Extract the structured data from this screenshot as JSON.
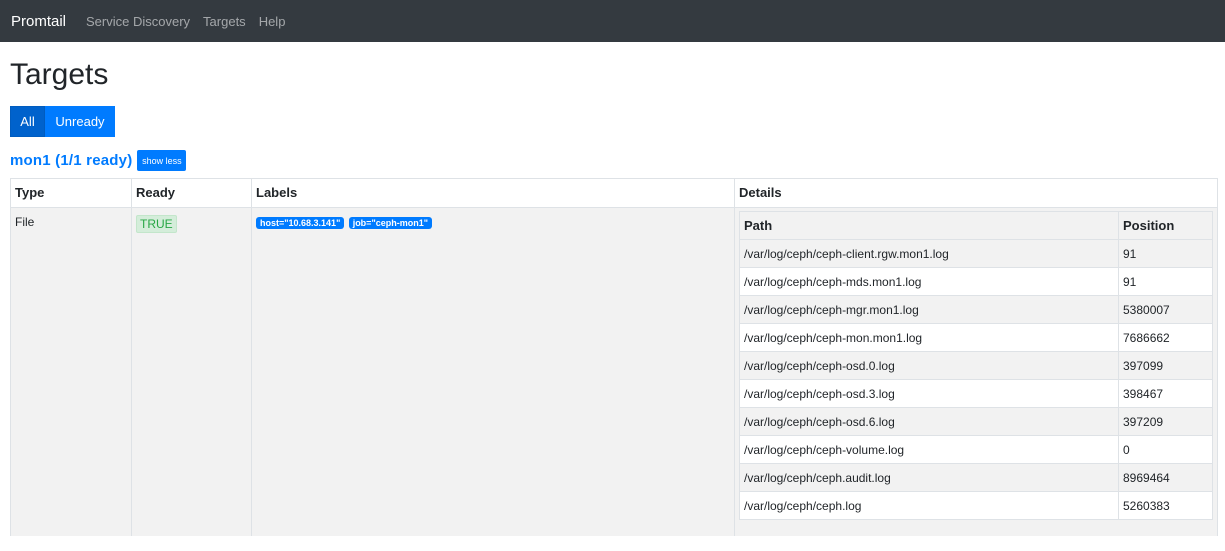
{
  "nav": {
    "brand": "Promtail",
    "links": [
      "Service Discovery",
      "Targets",
      "Help"
    ]
  },
  "page": {
    "title": "Targets"
  },
  "filter": {
    "all_label": "All",
    "unready_label": "Unready"
  },
  "job": {
    "title": "mon1 (1/1 ready)",
    "toggle_label": "show less"
  },
  "table": {
    "headers": [
      "Type",
      "Ready",
      "Labels",
      "Details"
    ],
    "row": {
      "type": "File",
      "ready": "TRUE",
      "labels": [
        "host=\"10.68.3.141\"",
        "job=\"ceph-mon1\""
      ]
    }
  },
  "details": {
    "headers": [
      "Path",
      "Position"
    ],
    "rows": [
      [
        "/var/log/ceph/ceph-client.rgw.mon1.log",
        "91"
      ],
      [
        "/var/log/ceph/ceph-mds.mon1.log",
        "91"
      ],
      [
        "/var/log/ceph/ceph-mgr.mon1.log",
        "5380007"
      ],
      [
        "/var/log/ceph/ceph-mon.mon1.log",
        "7686662"
      ],
      [
        "/var/log/ceph/ceph-osd.0.log",
        "397099"
      ],
      [
        "/var/log/ceph/ceph-osd.3.log",
        "398467"
      ],
      [
        "/var/log/ceph/ceph-osd.6.log",
        "397209"
      ],
      [
        "/var/log/ceph/ceph-volume.log",
        "0"
      ],
      [
        "/var/log/ceph/ceph.audit.log",
        "8969464"
      ],
      [
        "/var/log/ceph/ceph.log",
        "5260383"
      ]
    ]
  }
}
